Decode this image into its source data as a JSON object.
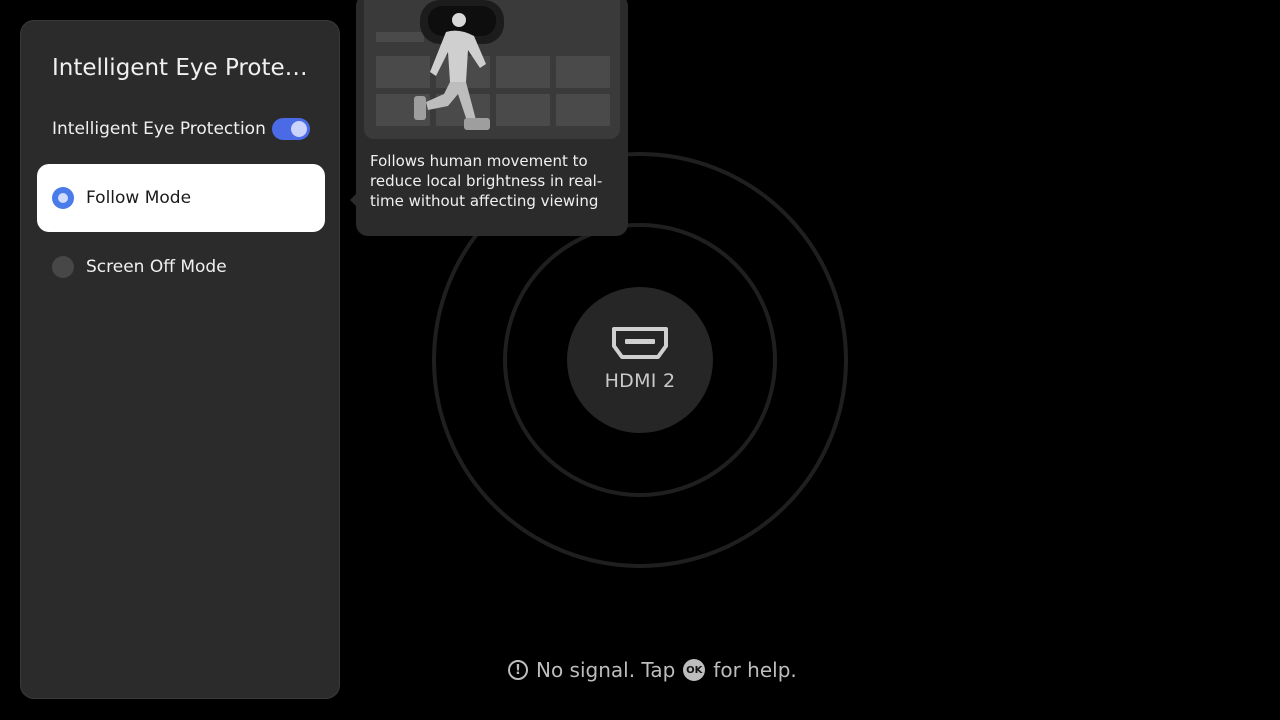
{
  "panel": {
    "title": "Intelligent Eye Protection",
    "toggle": {
      "label": "Intelligent Eye Protection",
      "on": true
    },
    "options": [
      {
        "label": "Follow Mode",
        "selected": true
      },
      {
        "label": "Screen Off Mode",
        "selected": false
      }
    ]
  },
  "tooltip": {
    "text": "Follows human movement to reduce local brightness in real-time without affecting viewing",
    "illustration_icon": "vr-headset-person-walking-illustration"
  },
  "source": {
    "label": "HDMI 2",
    "icon": "hdmi-port-icon"
  },
  "status": {
    "prefix": "No signal. Tap",
    "ok_key": "OK",
    "suffix": "for help.",
    "icon": "alert-circle-icon"
  },
  "colors": {
    "accent": "#4a7bea",
    "panel_bg": "#2b2b2b",
    "screen_bg": "#000000"
  }
}
